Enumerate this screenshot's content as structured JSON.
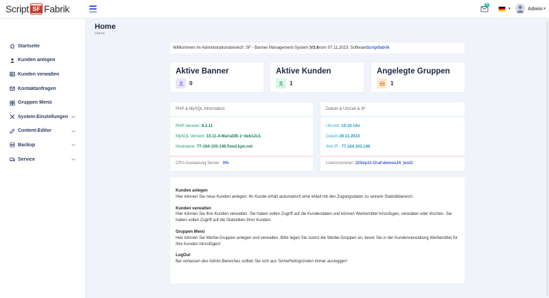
{
  "header": {
    "logo": {
      "part1": "Script",
      "badge": "SF",
      "part2": "Fabrik"
    },
    "mail_count": "0",
    "user_label": "Admin",
    "colors": {
      "accent": "#3a5bd9",
      "badge": "#1abc9c"
    },
    "flag_colors": [
      "#000000",
      "#dd0000",
      "#ffce00"
    ]
  },
  "sidebar": {
    "items": [
      {
        "label": "Startseite",
        "icon": "home-icon",
        "chevron": false
      },
      {
        "label": "Kunden anlegen",
        "icon": "user-icon",
        "chevron": false
      },
      {
        "label": "Kunden verwalten",
        "icon": "table-icon",
        "chevron": false
      },
      {
        "label": "Kontaktanfragen",
        "icon": "envelope-icon",
        "chevron": false
      },
      {
        "label": "Gruppen Menü",
        "icon": "grid-icon",
        "chevron": false
      },
      {
        "label": "System-Einstellungen",
        "icon": "tools-icon",
        "chevron": true
      },
      {
        "label": "Content-Editor",
        "icon": "edit-icon",
        "chevron": true
      },
      {
        "label": "Backup",
        "icon": "database-icon",
        "chevron": true
      },
      {
        "label": "Service",
        "icon": "truck-icon",
        "chevron": true
      }
    ]
  },
  "page": {
    "title": "Home",
    "breadcrumb": "Home"
  },
  "welcome": {
    "prefix": "Willkommen im Administrationsbereich: SF - Banner Management-System | ",
    "version": "V3.6",
    "middle": " vom 07.11.2023: Software ",
    "brand": "Scriptfabrik"
  },
  "stats": [
    {
      "title": "Aktive Banner",
      "value": "0",
      "icon": "user-icon",
      "icon_bg": "#e9e6fb",
      "icon_color": "#6c5ce7"
    },
    {
      "title": "Aktive Kunden",
      "value": "1",
      "icon": "user-icon",
      "icon_bg": "#dcf5e9",
      "icon_color": "#1a9b6c"
    },
    {
      "title": "Angelegte Gruppen",
      "value": "1",
      "icon": "server-icon",
      "icon_bg": "#fcebd6",
      "icon_color": "#e67e22"
    }
  ],
  "php_panel": {
    "title": "PHP & MySQL Information",
    "rows": [
      {
        "key": "PHP-Version: ",
        "value": "8.2.11"
      },
      {
        "key": "MySQL Version: ",
        "value": "10.11.4-MariaDB-1~deb12u1"
      },
      {
        "key": "Hostname: ",
        "value": "77-164-103-146.fixed.kpn.net"
      }
    ],
    "footer_key": "CPU-Auslastung Server : ",
    "footer_value": "0%"
  },
  "date_panel": {
    "title": "Datum & Uhrzeit & IP",
    "rows": [
      {
        "key": "Uhrzeit: ",
        "value": "15:10 Uhr"
      },
      {
        "key": "Datum:",
        "value": "29.11.2023"
      },
      {
        "key": "Ihre IP : ",
        "value": "77.164.103.146"
      }
    ],
    "footer_key": "Lizenznummer: ",
    "footer_value": "22Sep11-Graf-demos24_test3"
  },
  "descriptions": [
    {
      "title": "Kunden anlegen",
      "text": "Hier können Sie neue Kunden anlegen. Ihr Kunde erhält automatisch eine eMail mit den Zugangsdaten zu seinem Statistikbereich."
    },
    {
      "title": "Kunden verwalten",
      "text": "Hier können Sie Ihre Kunden verwalten. Sie haben vollen Zugriff auf die Kundendaten und können Werbemittel hinzufügen, verwalten oder löschen. Sie haben vollen Zugriff auf die Statistiken Ihrer Kunden."
    },
    {
      "title": "Gruppen Menü",
      "text": "Hier können Sie Werbe-Gruppen anlegen und verwalten. Bitte legen Sie zuerst die Werbe-Gruppen an, bevor Sie in der Kundenverwaltung Werbemittel für Ihre Kunden hinzufügen!"
    },
    {
      "title": "LogOut",
      "text": "Bei verlassen des Admin-Bereiches sollten Sie sich aus Sicherheitsgründen immer ausloggen!"
    }
  ]
}
